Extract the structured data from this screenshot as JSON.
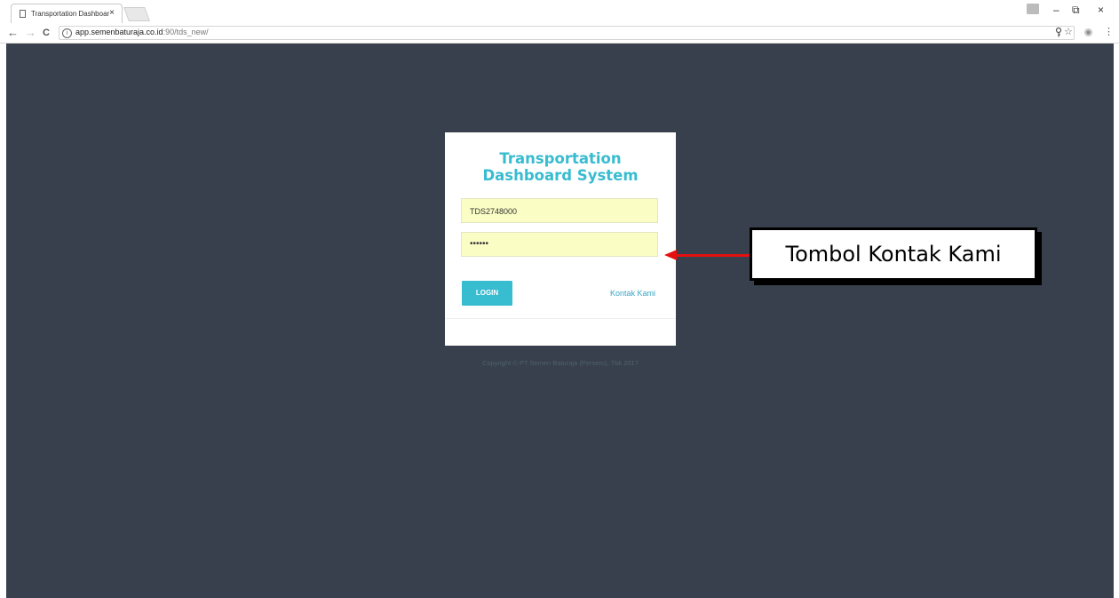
{
  "browser": {
    "tab_title": "Transportation Dashboar",
    "tab_close": "×",
    "url_host": "app.semenbaturaja.co.id",
    "url_path": ":90/tds_new/",
    "nav_icons": {
      "back": "←",
      "forward": "→",
      "reload": "C"
    },
    "window_controls": {
      "minimize": "–",
      "restore": "⧉",
      "close": "×"
    },
    "toolbar_icons": {
      "key": "key-icon",
      "star": "☆",
      "extension": "extension-icon",
      "menu": "⋮"
    }
  },
  "login": {
    "title": "Transportation Dashboard System",
    "username_value": "TDS2748000",
    "password_value": "••••••",
    "login_label": "LOGIN",
    "contact_label": "Kontak Kami",
    "copyright": "Copyright © PT Semen Baturaja (Persero), Tbk 2017"
  },
  "annotation": {
    "label": "Tombol Kontak Kami"
  },
  "colors": {
    "page_background": "#37404c",
    "accent": "#38bcd0",
    "field_background": "#fafec4",
    "arrow": "#e41010"
  }
}
